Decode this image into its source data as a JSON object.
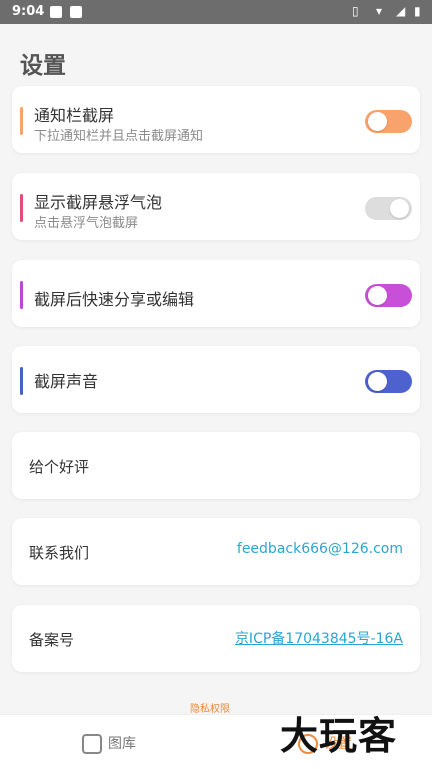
{
  "status": {
    "time": "9:04",
    "right_icons": "▯ ▾ ◢ ▮"
  },
  "page": {
    "title": "设置"
  },
  "settings": [
    {
      "title": "通知栏截屏",
      "subtitle": "下拉通知栏并且点击截屏通知",
      "accent": "#f6a46d",
      "toggle": true,
      "toggle_color": "#f8a36c"
    },
    {
      "title": "显示截屏悬浮气泡",
      "subtitle": "点击悬浮气泡截屏",
      "accent": "#e14d79",
      "toggle": false,
      "toggle_color": "#dddddd"
    },
    {
      "title": "截屏后快速分享或编辑",
      "subtitle": "",
      "accent": "#b84bd0",
      "toggle": true,
      "toggle_color": "#c84fd7"
    },
    {
      "title": "截屏声音",
      "subtitle": "",
      "accent": "#4a5fc7",
      "toggle": true,
      "toggle_color": "#4d62cf"
    }
  ],
  "review": {
    "label": "给个好评"
  },
  "contact": {
    "label": "联系我们",
    "value": "feedback666@126.com"
  },
  "icp": {
    "label": "备案号",
    "value": "京ICP备17043845号-16A"
  },
  "footer": {
    "privacy": "隐私权限"
  },
  "nav": {
    "gallery": "图库",
    "settings": "设置"
  },
  "watermark": "大玩客"
}
